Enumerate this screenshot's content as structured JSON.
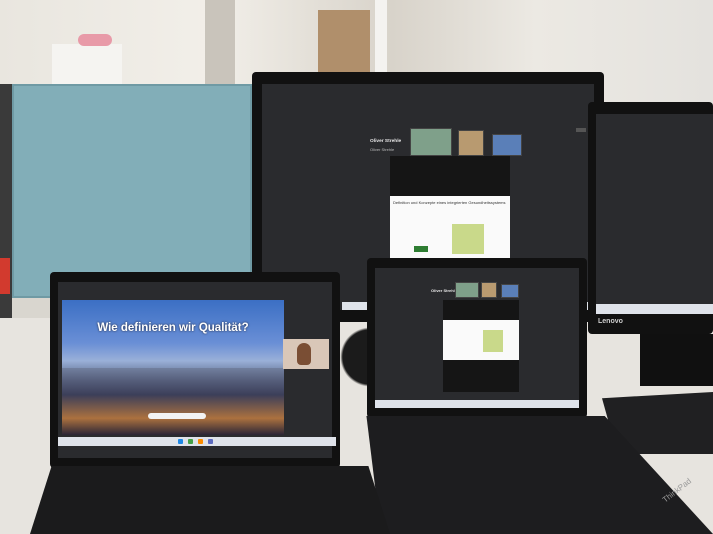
{
  "scene": "office desk with monitors and laptops showing a video meeting",
  "center_monitor": {
    "meeting_name": "Oliver Strehle",
    "meeting_subtitle": "Oliver Strehle",
    "document_title": "Definition und Konzepte eines integrierten Gesundheitssystems"
  },
  "middle_laptop": {
    "meeting_name": "Oliver Strehle"
  },
  "left_laptop": {
    "presentation_title": "Wie definieren wir Qualität?"
  },
  "brand": {
    "monitor_logo": "Lenovo",
    "laptop_logo": "ThinkPad"
  },
  "colors": {
    "partition": "#82aeb8",
    "slide_sky": "#3b6fc4",
    "screen_bg": "#2a2b2e"
  }
}
